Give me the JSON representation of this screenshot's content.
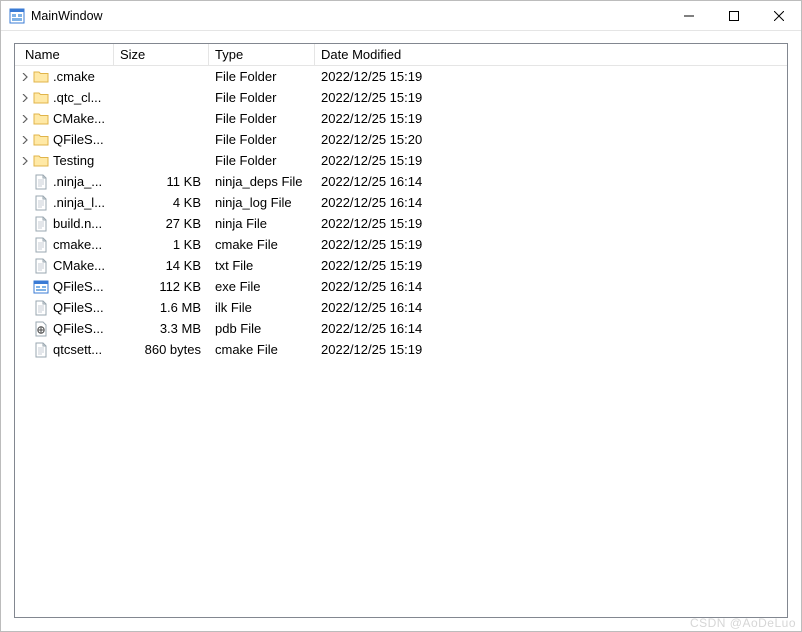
{
  "title": "MainWindow",
  "columns": {
    "name": "Name",
    "size": "Size",
    "type": "Type",
    "date": "Date Modified"
  },
  "rows": [
    {
      "kind": "folder",
      "name": ".cmake",
      "size": "",
      "type": "File Folder",
      "date": "2022/12/25 15:19"
    },
    {
      "kind": "folder",
      "name": ".qtc_cl...",
      "size": "",
      "type": "File Folder",
      "date": "2022/12/25 15:19"
    },
    {
      "kind": "folder",
      "name": "CMake...",
      "size": "",
      "type": "File Folder",
      "date": "2022/12/25 15:19"
    },
    {
      "kind": "folder",
      "name": "QFileS...",
      "size": "",
      "type": "File Folder",
      "date": "2022/12/25 15:20"
    },
    {
      "kind": "folder",
      "name": "Testing",
      "size": "",
      "type": "File Folder",
      "date": "2022/12/25 15:19"
    },
    {
      "kind": "file",
      "name": ".ninja_...",
      "size": "11 KB",
      "type": "ninja_deps File",
      "date": "2022/12/25 16:14"
    },
    {
      "kind": "file",
      "name": ".ninja_l...",
      "size": "4 KB",
      "type": "ninja_log File",
      "date": "2022/12/25 16:14"
    },
    {
      "kind": "file",
      "name": "build.n...",
      "size": "27 KB",
      "type": "ninja File",
      "date": "2022/12/25 15:19"
    },
    {
      "kind": "file",
      "name": "cmake...",
      "size": "1 KB",
      "type": "cmake File",
      "date": "2022/12/25 15:19"
    },
    {
      "kind": "file",
      "name": "CMake...",
      "size": "14 KB",
      "type": "txt File",
      "date": "2022/12/25 15:19"
    },
    {
      "kind": "exe",
      "name": "QFileS...",
      "size": "112 KB",
      "type": "exe File",
      "date": "2022/12/25 16:14"
    },
    {
      "kind": "file",
      "name": "QFileS...",
      "size": "1.6 MB",
      "type": "ilk File",
      "date": "2022/12/25 16:14"
    },
    {
      "kind": "pdb",
      "name": "QFileS...",
      "size": "3.3 MB",
      "type": "pdb File",
      "date": "2022/12/25 16:14"
    },
    {
      "kind": "file",
      "name": "qtcsett...",
      "size": "860 bytes",
      "type": "cmake File",
      "date": "2022/12/25 15:19"
    }
  ],
  "watermark": "CSDN @AoDeLuo"
}
